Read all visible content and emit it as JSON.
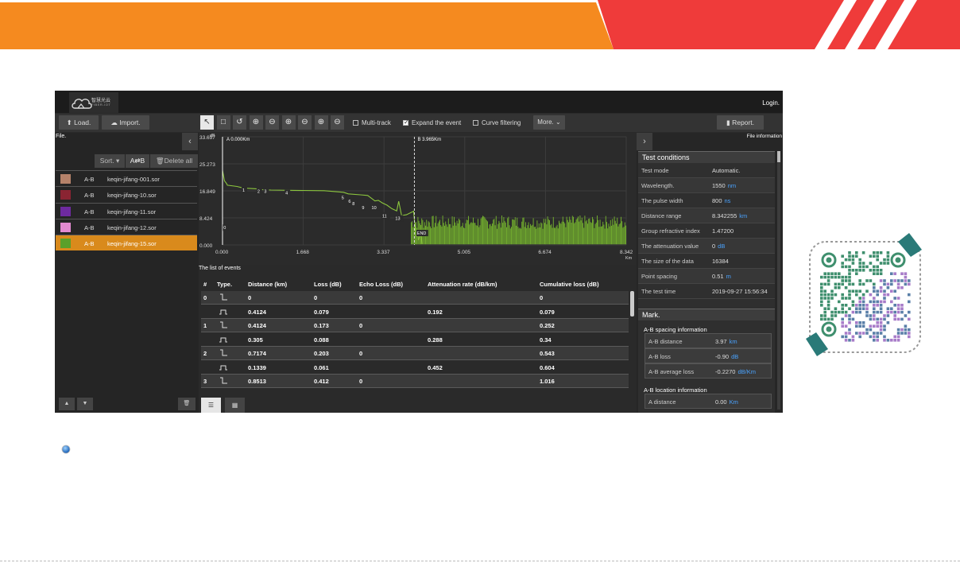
{
  "colors": {
    "banner_orange": "#f58a1f",
    "banner_red": "#ef3b3a",
    "selected_row": "#d98a1c",
    "trace": "#8cc63e",
    "accent_blue": "#4aa3ff"
  },
  "header": {
    "logo_cn": "智慧光云",
    "logo_en": "FIBER-IOT",
    "login": "Login."
  },
  "toolbar": {
    "load": "Load.",
    "import": "Import.",
    "report": "Report.",
    "more": "More.",
    "tools": [
      {
        "name": "pointer-tool",
        "icon": "↖"
      },
      {
        "name": "box-select-tool",
        "icon": "□"
      },
      {
        "name": "reset-tool",
        "icon": "↺"
      },
      {
        "name": "zoom-in-tool",
        "icon": "⊕"
      },
      {
        "name": "zoom-out-tool",
        "icon": "⊖"
      },
      {
        "name": "zoom-x-in-tool",
        "icon": "⊕"
      },
      {
        "name": "zoom-x-out-tool",
        "icon": "⊖"
      },
      {
        "name": "zoom-y-in-tool",
        "icon": "⊕"
      },
      {
        "name": "zoom-y-out-tool",
        "icon": "⊖"
      }
    ],
    "multi_track": "Multi-track",
    "expand_event": "Expand the event",
    "curve_filtering": "Curve filtering"
  },
  "left": {
    "file_label": "File.",
    "sort": "Sort.",
    "ab": "A⇄B",
    "delete_all": "Delete all",
    "files": [
      {
        "color": "#b5826a",
        "ab": "A-B",
        "name": "keqin-jifang-001.sor",
        "selected": false
      },
      {
        "color": "#8a2432",
        "ab": "A-B",
        "name": "keqin-jifang-10.sor",
        "selected": false
      },
      {
        "color": "#6e2aa0",
        "ab": "A-B",
        "name": "keqin-jifang-11.sor",
        "selected": false
      },
      {
        "color": "#e28ad0",
        "ab": "A-B",
        "name": "keqin-jifang-12.sor",
        "selected": false
      },
      {
        "color": "#5aa02a",
        "ab": "A-B",
        "name": "keqin-jifang-15.sor",
        "selected": true
      }
    ]
  },
  "chart_data": {
    "type": "line",
    "title": "",
    "ylabel": "dB",
    "xlabel": "Km",
    "x_ticks": [
      "0.000",
      "1.668",
      "3.337",
      "5.005",
      "6.674",
      "8.342"
    ],
    "y_ticks": [
      "33.697",
      "25.273",
      "16.849",
      "8.424",
      "0.000"
    ],
    "xlim": [
      0,
      8.342
    ],
    "ylim": [
      0,
      33.697
    ],
    "marker_a": {
      "label": "A 0.000Km",
      "x": 0
    },
    "marker_b": {
      "label": "B 3.965Km",
      "x": 3.965
    },
    "series": [
      {
        "values": [
          [
            0,
            23.2
          ],
          [
            0.04,
            20
          ],
          [
            0.08,
            19.2
          ],
          [
            0.1,
            18.6
          ],
          [
            0.3,
            18.2
          ],
          [
            0.41,
            17.8
          ],
          [
            0.45,
            17.7
          ],
          [
            0.7,
            17.5
          ],
          [
            0.72,
            17.3
          ],
          [
            1.0,
            17.1
          ],
          [
            1.5,
            17.0
          ],
          [
            2.1,
            16.9
          ],
          [
            2.5,
            16.4
          ],
          [
            2.6,
            15.9
          ],
          [
            2.85,
            15.6
          ],
          [
            3.0,
            15.4
          ],
          [
            3.15,
            13.7
          ],
          [
            3.22,
            13.9
          ],
          [
            3.3,
            13.1
          ],
          [
            3.4,
            12.4
          ],
          [
            3.5,
            11.3
          ],
          [
            3.6,
            10.6
          ],
          [
            3.64,
            13.6
          ],
          [
            3.7,
            9.2
          ],
          [
            3.8,
            9.4
          ],
          [
            3.95,
            10.5
          ],
          [
            3.97,
            6.8
          ],
          [
            4.0,
            2.5
          ],
          [
            4.02,
            4.2
          ],
          [
            4.05,
            1.5
          ],
          [
            4.1,
            3.8
          ],
          [
            4.12,
            0.3
          ]
        ]
      }
    ],
    "event_labels": [
      {
        "text": "1",
        "x": 0.41,
        "y": 16.6
      },
      {
        "text": "2",
        "x": 0.72,
        "y": 16.2
      },
      {
        "text": "3",
        "x": 0.86,
        "y": 16.2
      },
      {
        "text": "4",
        "x": 1.3,
        "y": 15.7
      },
      {
        "text": "5",
        "x": 2.46,
        "y": 14.3
      },
      {
        "text": "6",
        "x": 2.6,
        "y": 13.1
      },
      {
        "text": "8",
        "x": 2.68,
        "y": 12.4
      },
      {
        "text": "9",
        "x": 2.88,
        "y": 11.2
      },
      {
        "text": "10",
        "x": 3.08,
        "y": 11.2
      },
      {
        "text": "11",
        "x": 3.3,
        "y": 8.6
      },
      {
        "text": "13",
        "x": 3.57,
        "y": 7.8
      },
      {
        "text": "0",
        "x": 0.02,
        "y": 4.9
      },
      {
        "text": "END",
        "x": 4.02,
        "y": 3.2
      }
    ]
  },
  "events": {
    "title": "The list of events",
    "columns": [
      "#",
      "Type.",
      "Distance (km)",
      "Loss (dB)",
      "Echo Loss (dB)",
      "Attenuation rate (dB/km)",
      "Cumulative loss (dB)"
    ],
    "rows": [
      {
        "num": "0",
        "type": "event",
        "distance": "0",
        "loss": "0",
        "echo": "0",
        "atten": "",
        "cum": "0"
      },
      {
        "num": "",
        "type": "span",
        "distance": "0.4124",
        "loss": "0.079",
        "echo": "",
        "atten": "0.192",
        "cum": "0.079"
      },
      {
        "num": "1",
        "type": "event",
        "distance": "0.4124",
        "loss": "0.173",
        "echo": "0",
        "atten": "",
        "cum": "0.252"
      },
      {
        "num": "",
        "type": "span",
        "distance": "0.305",
        "loss": "0.088",
        "echo": "",
        "atten": "0.288",
        "cum": "0.34"
      },
      {
        "num": "2",
        "type": "event",
        "distance": "0.7174",
        "loss": "0.203",
        "echo": "0",
        "atten": "",
        "cum": "0.543"
      },
      {
        "num": "",
        "type": "span",
        "distance": "0.1339",
        "loss": "0.061",
        "echo": "",
        "atten": "0.452",
        "cum": "0.604"
      },
      {
        "num": "3",
        "type": "event",
        "distance": "0.8513",
        "loss": "0.412",
        "echo": "0",
        "atten": "",
        "cum": "1.016"
      }
    ]
  },
  "right": {
    "file_info": "File information",
    "test_conditions": "Test conditions",
    "params": [
      {
        "k": "Test mode",
        "v": "Automatic.",
        "u": ""
      },
      {
        "k": "Wavelength.",
        "v": "1550",
        "u": "nm"
      },
      {
        "k": "The pulse width",
        "v": "800",
        "u": "ns"
      },
      {
        "k": "Distance range",
        "v": "8.342255",
        "u": "km"
      },
      {
        "k": "Group refractive index",
        "v": "1.47200",
        "u": ""
      },
      {
        "k": "The attenuation value",
        "v": "0",
        "u": "dB"
      },
      {
        "k": "The size of the data",
        "v": "16384",
        "u": ""
      },
      {
        "k": "Point spacing",
        "v": "0.51",
        "u": "m"
      },
      {
        "k": "The test time",
        "v": "2019-09-27 15:56:34",
        "u": ""
      }
    ],
    "mark": "Mark.",
    "ab_spacing": "A-B spacing information",
    "ab_rows": [
      {
        "k": "A-B distance",
        "v": "3.97",
        "u": "km"
      },
      {
        "k": "A-B loss",
        "v": "-0.90",
        "u": "dB"
      },
      {
        "k": "A-B average loss",
        "v": "-0.2270",
        "u": "dB/Km"
      }
    ],
    "ab_location": "A-B location information",
    "loc_rows": [
      {
        "k": "A distance",
        "v": "0.00",
        "u": "Km"
      }
    ]
  }
}
